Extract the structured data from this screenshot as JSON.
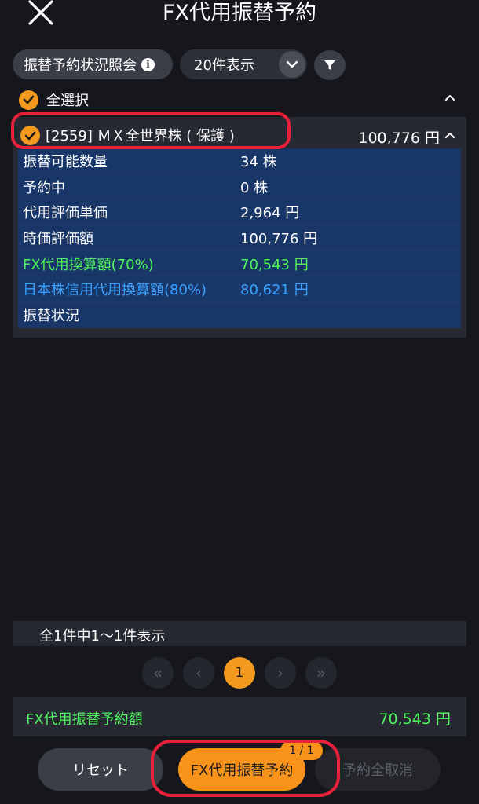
{
  "header": {
    "title": "FX代用振替予約"
  },
  "toolbar": {
    "status_label": "振替予約状況照会",
    "count_label": "20件表示"
  },
  "select_all": {
    "label": "全選択"
  },
  "holding": {
    "name": "[2559] ＭＸ全世界株 ( 保護 )",
    "amount": "100,776 円",
    "details": [
      {
        "label": "振替可能数量",
        "value": "34 株"
      },
      {
        "label": "予約中",
        "value": "0 株"
      },
      {
        "label": "代用評価単価",
        "value": "2,964 円"
      },
      {
        "label": "時価評価額",
        "value": "100,776 円"
      },
      {
        "label": "FX代用換算額(70%)",
        "value": "70,543 円"
      },
      {
        "label": "日本株信用代用換算額(80%)",
        "value": "80,621 円"
      },
      {
        "label": "振替状況",
        "value": ""
      }
    ]
  },
  "results": {
    "summary": "全1件中1〜1件表示"
  },
  "pager": {
    "first": "«",
    "prev": "‹",
    "current": "1",
    "next": "›",
    "last": "»"
  },
  "total": {
    "label": "FX代用振替予約額",
    "value": "70,543 円"
  },
  "actions": {
    "reset": "リセット",
    "reserve": "FX代用振替予約",
    "badge": "1 / 1",
    "cancel_all": "予約全取消"
  },
  "colors": {
    "accent": "#f39a1e",
    "green": "#4ef45d",
    "blue": "#3aa2ff",
    "highlight": "#e8203a"
  }
}
